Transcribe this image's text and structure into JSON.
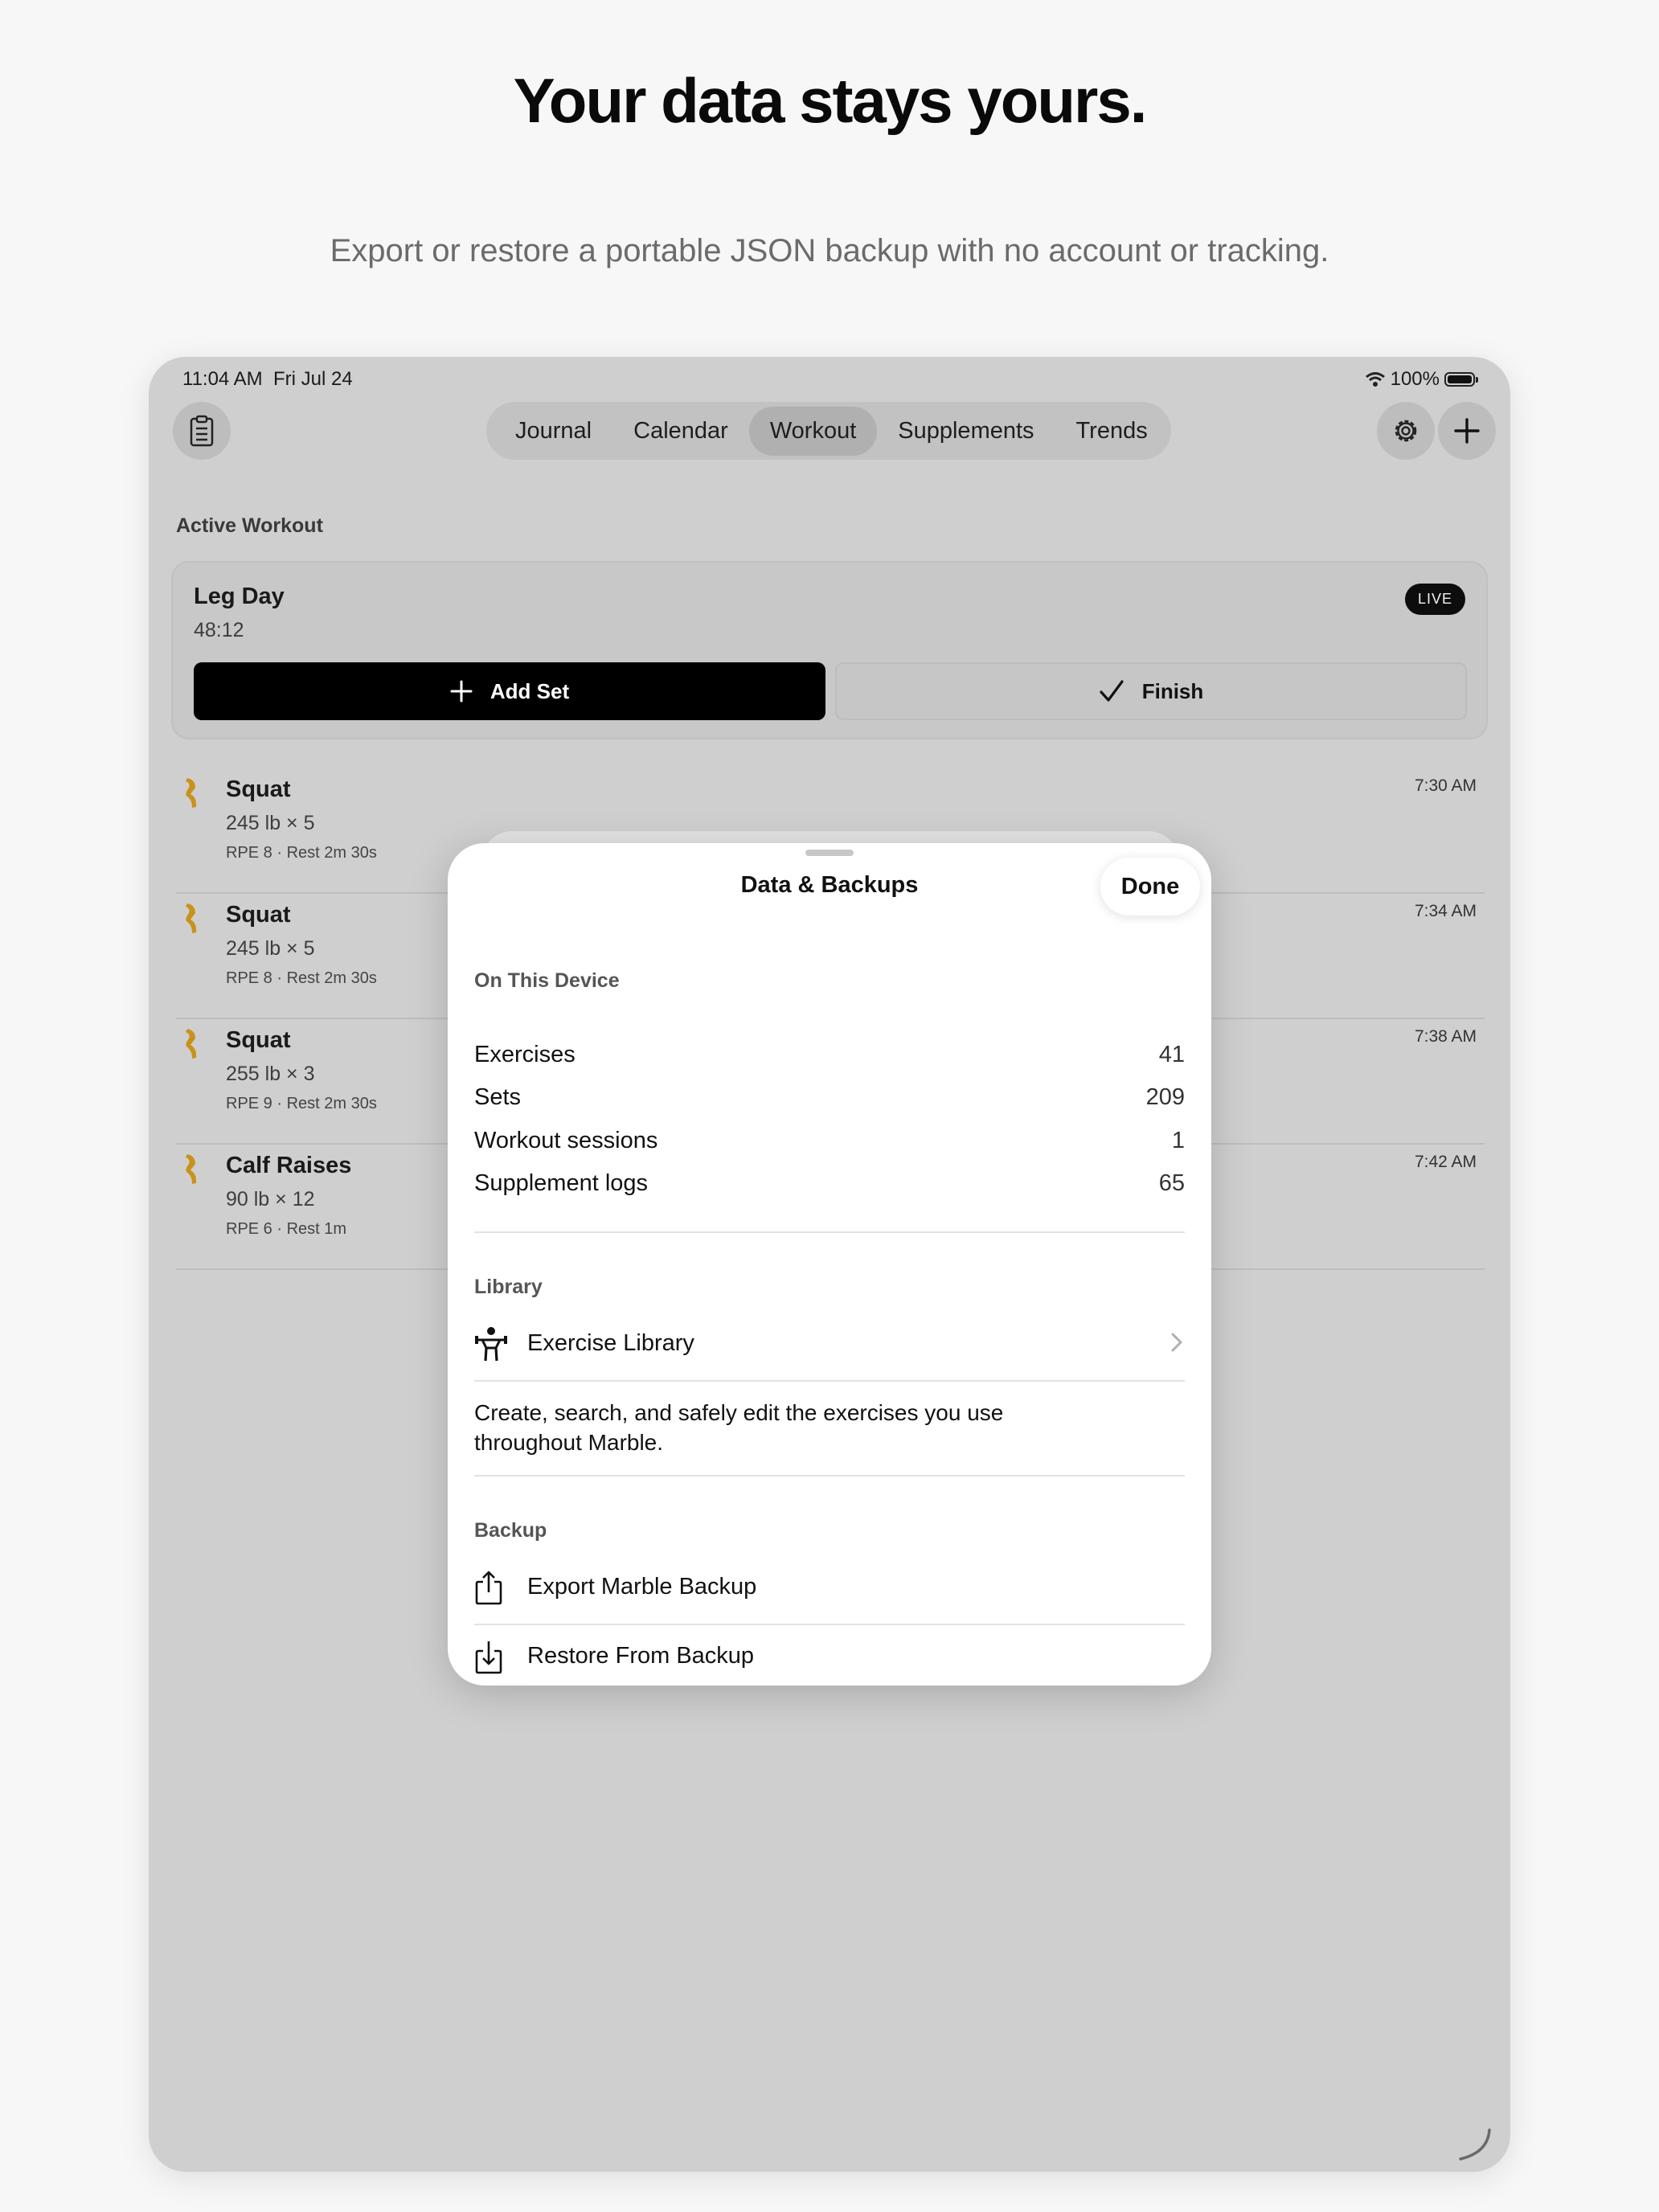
{
  "headline": "Your data stays yours.",
  "subline": "Export or restore a portable JSON backup with no account or tracking.",
  "status_bar": {
    "time": "11:04 AM",
    "date": "Fri Jul 24",
    "battery": "100%"
  },
  "tabs": [
    "Journal",
    "Calendar",
    "Workout",
    "Supplements",
    "Trends"
  ],
  "active_tab": "Workout",
  "section_title": "Active Workout",
  "active_workout": {
    "name": "Leg Day",
    "elapsed": "48:12",
    "badge": "LIVE",
    "add_set_label": "Add Set",
    "finish_label": "Finish"
  },
  "entries": [
    {
      "name": "Squat",
      "weight": "245 lb × 5",
      "meta": "RPE 8 · Rest 2m 30s",
      "time": "7:30 AM"
    },
    {
      "name": "Squat",
      "weight": "245 lb × 5",
      "meta": "RPE 8 · Rest 2m 30s",
      "time": "7:34 AM"
    },
    {
      "name": "Squat",
      "weight": "255 lb × 3",
      "meta": "RPE 9 · Rest 2m 30s",
      "time": "7:38 AM"
    },
    {
      "name": "Calf Raises",
      "weight": "90 lb × 12",
      "meta": "RPE 6 · Rest 1m",
      "time": "7:42 AM"
    }
  ],
  "sheet": {
    "title": "Data & Backups",
    "done_label": "Done",
    "device_section": "On This Device",
    "stats": [
      {
        "label": "Exercises",
        "value": "41"
      },
      {
        "label": "Sets",
        "value": "209"
      },
      {
        "label": "Workout sessions",
        "value": "1"
      },
      {
        "label": "Supplement logs",
        "value": "65"
      }
    ],
    "library_section": "Library",
    "library_link": "Exercise Library",
    "library_desc": "Create, search, and safely edit the exercises you use throughout Marble.",
    "backup_section": "Backup",
    "export_label": "Export Marble Backup",
    "restore_label": "Restore From Backup"
  },
  "colors": {
    "accent_icon": "#d4a017",
    "primary_button": "#000000",
    "dim_background": "#cfcfcf"
  },
  "icons": [
    "clipboard-icon",
    "gear-icon",
    "plus-icon",
    "leg-icon",
    "checkmark-icon",
    "weightlifter-icon",
    "chevron-right-icon",
    "share-export-icon",
    "restore-import-icon",
    "wifi-icon",
    "battery-icon"
  ]
}
